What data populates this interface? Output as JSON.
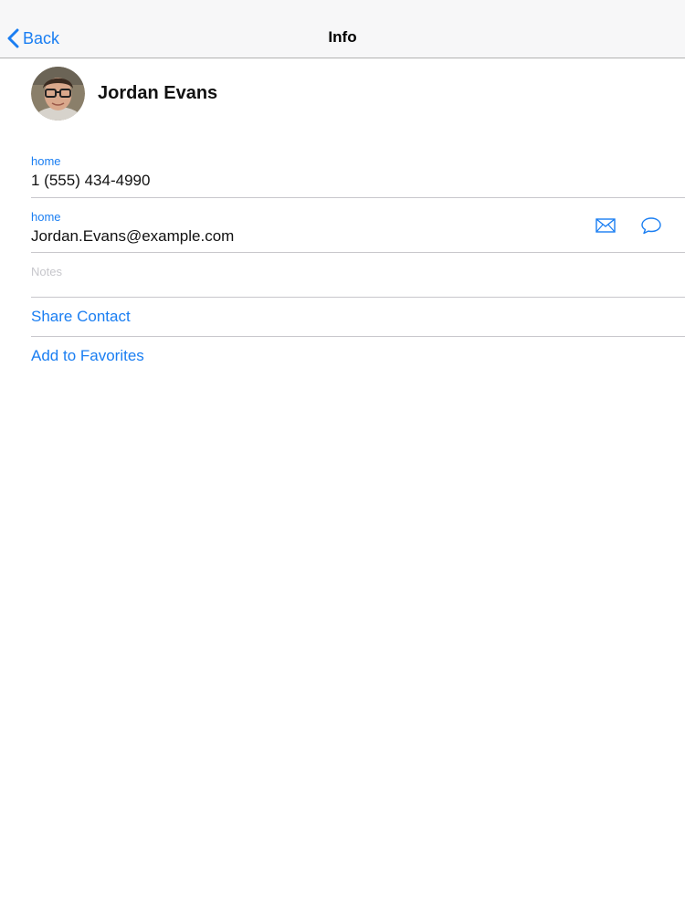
{
  "navbar": {
    "back_label": "Back",
    "title": "Info"
  },
  "contact": {
    "name": "Jordan Evans"
  },
  "phone": {
    "label": "home",
    "value": "1 (555) 434-4990"
  },
  "email": {
    "label": "home",
    "value": "Jordan.Evans@example.com",
    "icons": [
      "mail-icon",
      "message-bubble-icon"
    ]
  },
  "notes": {
    "placeholder": "Notes"
  },
  "actions": {
    "share_label": "Share Contact",
    "favorites_label": "Add to Favorites"
  },
  "colors": {
    "accent": "#1a7ef2",
    "divider": "#c8c7cc",
    "navbar_bg": "#f7f7f8"
  }
}
